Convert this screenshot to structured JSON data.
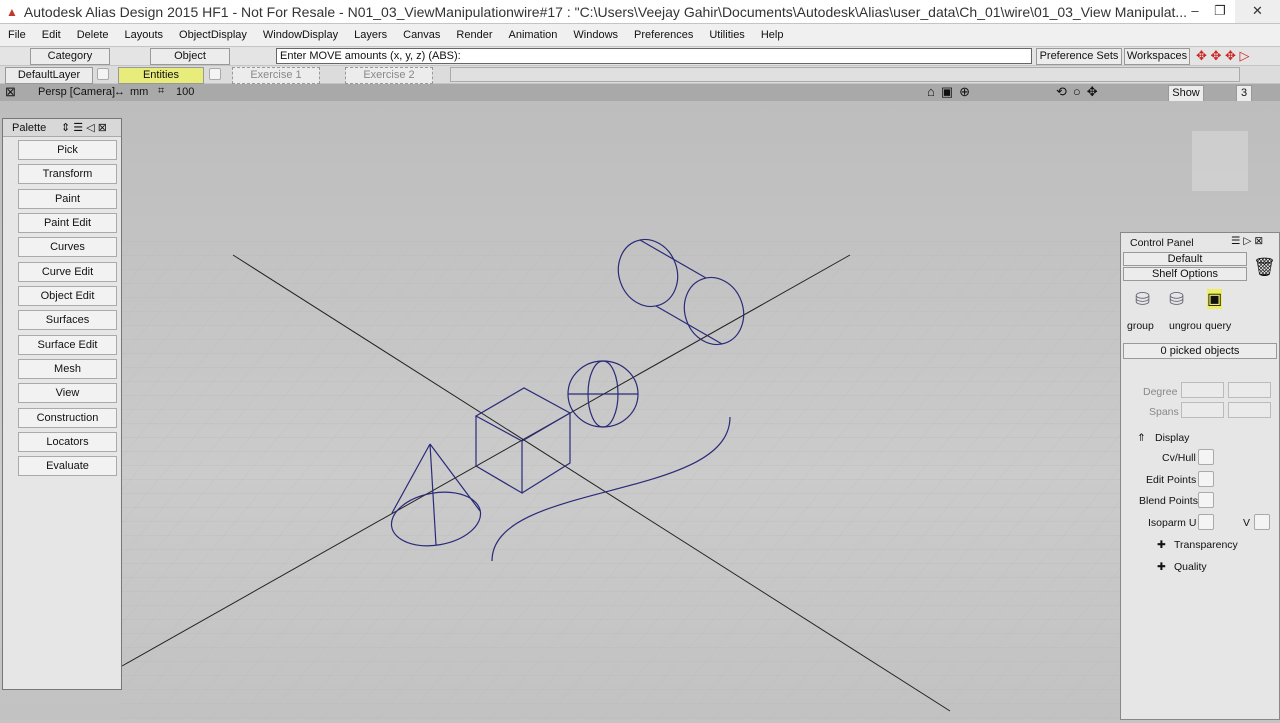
{
  "title": "Autodesk Alias Design 2015 HF1 - Not For Resale   - N01_03_ViewManipulationwire#17 : \"C:\\Users\\Veejay Gahir\\Documents\\Autodesk\\Alias\\user_data\\Ch_01\\wire\\01_03_View Manipulat...",
  "menu": [
    "File",
    "Edit",
    "Delete",
    "Layouts",
    "ObjectDisplay",
    "WindowDisplay",
    "Layers",
    "Canvas",
    "Render",
    "Animation",
    "Windows",
    "Preferences",
    "Utilities",
    "Help"
  ],
  "toolbar": {
    "category": "Category",
    "object": "Object",
    "prompt": "Enter MOVE amounts (x, y, z) (ABS):",
    "preference_sets": "Preference Sets",
    "workspaces": "Workspaces"
  },
  "layers": {
    "default": "DefaultLayer",
    "entities": "Entities",
    "exercise1": "Exercise 1",
    "exercise2": "Exercise 2",
    "entities_color": "#e8ec7a"
  },
  "viewport": {
    "camera": "Persp [Camera]",
    "units": "mm",
    "grid": "100",
    "show": "Show",
    "layout_num": "3"
  },
  "palette": {
    "title": "Palette",
    "items": [
      "Pick",
      "Transform",
      "Paint",
      "Paint Edit",
      "Curves",
      "Curve Edit",
      "Object Edit",
      "Surfaces",
      "Surface Edit",
      "Mesh",
      "View",
      "Construction",
      "Locators",
      "Evaluate"
    ]
  },
  "control_panel": {
    "title": "Control Panel",
    "preset": "Default",
    "shelf": "Shelf Options",
    "shelf_items": [
      "group",
      "ungrou",
      "query"
    ],
    "picked": "0 picked objects",
    "degree": "Degree",
    "spans": "Spans",
    "display": "Display",
    "cv_hull": "Cv/Hull",
    "edit_points": "Edit Points",
    "blend_points": "Blend Points",
    "isoparm_u": "Isoparm U",
    "v": "V",
    "transparency": "Transparency",
    "quality": "Quality"
  },
  "wire_color": "#2a2a7a"
}
